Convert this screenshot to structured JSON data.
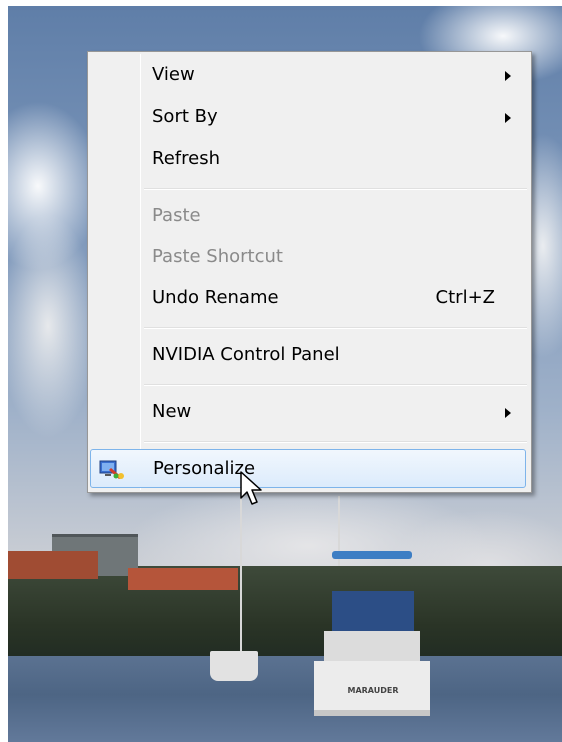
{
  "desktop": {
    "boat_name": "MARAUDER"
  },
  "context_menu": {
    "items": [
      {
        "label": "View",
        "shortcut": "",
        "submenu": true,
        "enabled": true
      },
      {
        "label": "Sort By",
        "shortcut": "",
        "submenu": true,
        "enabled": true
      },
      {
        "label": "Refresh",
        "shortcut": "",
        "submenu": false,
        "enabled": true
      },
      {
        "label": "Paste",
        "shortcut": "",
        "submenu": false,
        "enabled": false
      },
      {
        "label": "Paste Shortcut",
        "shortcut": "",
        "submenu": false,
        "enabled": false
      },
      {
        "label": "Undo Rename",
        "shortcut": "Ctrl+Z",
        "submenu": false,
        "enabled": true
      },
      {
        "label": "NVIDIA Control Panel",
        "shortcut": "",
        "submenu": false,
        "enabled": true
      },
      {
        "label": "New",
        "shortcut": "",
        "submenu": true,
        "enabled": true
      },
      {
        "label": "Personalize",
        "shortcut": "",
        "submenu": false,
        "enabled": true,
        "icon": "personalize-icon",
        "hovered": true
      }
    ]
  },
  "colors": {
    "menu_background": "#f0f0f0",
    "menu_border": "#979797",
    "highlight_border": "#7eb4ea",
    "disabled_text": "#8a8a8a"
  },
  "cursor": {
    "icon": "arrow-cursor-icon"
  }
}
